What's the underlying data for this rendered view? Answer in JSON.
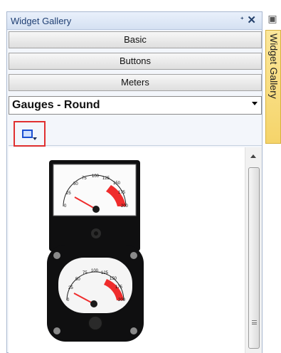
{
  "panel": {
    "title": "Widget Gallery",
    "pin_icon": "pin-icon",
    "close_icon": "close-icon"
  },
  "categories": [
    {
      "label": "Basic"
    },
    {
      "label": "Buttons"
    },
    {
      "label": "Meters"
    }
  ],
  "selector": {
    "value": "Gauges - Round"
  },
  "toolbar": {
    "view_icon": "view-mode-icon"
  },
  "gallery": {
    "items": [
      {
        "name": "rectangular-vu-meter",
        "scale_labels": [
          "0",
          "25",
          "50",
          "75",
          "100",
          "125",
          "150",
          "175",
          "200"
        ]
      },
      {
        "name": "round-vu-meter",
        "scale_labels": [
          "0",
          "25",
          "50",
          "75",
          "100",
          "125",
          "150",
          "175",
          "200"
        ]
      }
    ]
  },
  "sidetab": {
    "label": "Widget Gallery",
    "icon": "widget-gallery-icon"
  }
}
